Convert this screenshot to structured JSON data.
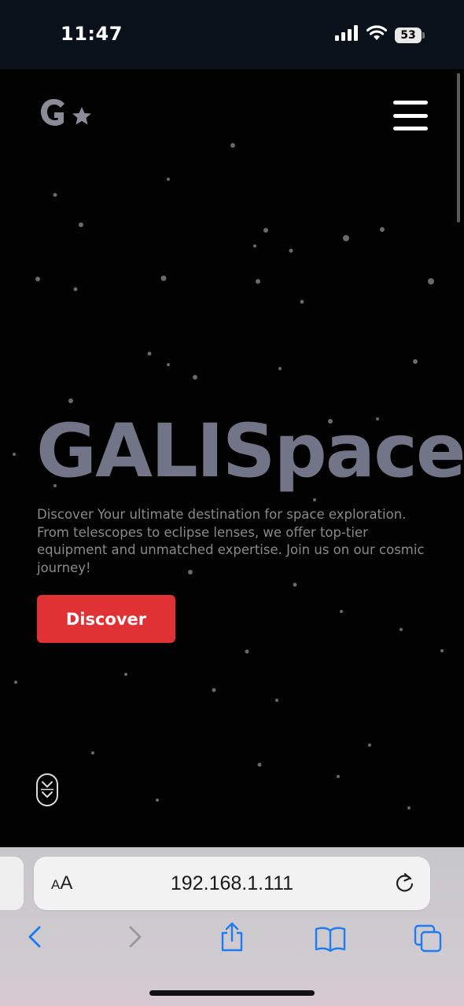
{
  "status_bar": {
    "time": "11:47",
    "battery": "53",
    "icons": [
      "signal-icon",
      "wifi-icon",
      "battery-icon"
    ]
  },
  "header": {
    "logo_icon": "galispace-logo-icon",
    "menu_icon": "hamburger-menu-icon"
  },
  "hero": {
    "title": "GALISpace",
    "description": "Discover Your ultimate destination for space exploration. From telescopes to eclipse lenses, we offer top-tier equipment and unmatched expertise. Join us on our cosmic journey!",
    "button_label": "Discover",
    "scroll_icon": "scroll-down-icon"
  },
  "browser": {
    "text_size_label": "AA",
    "url": "192.168.1.111",
    "toolbar_icons": [
      "back-icon",
      "forward-icon",
      "share-icon",
      "bookmarks-icon",
      "tabs-icon"
    ]
  },
  "colors": {
    "accent": "#e03134",
    "title": "#717587",
    "background": "#020202",
    "ios_blue": "#1f7bf2"
  }
}
